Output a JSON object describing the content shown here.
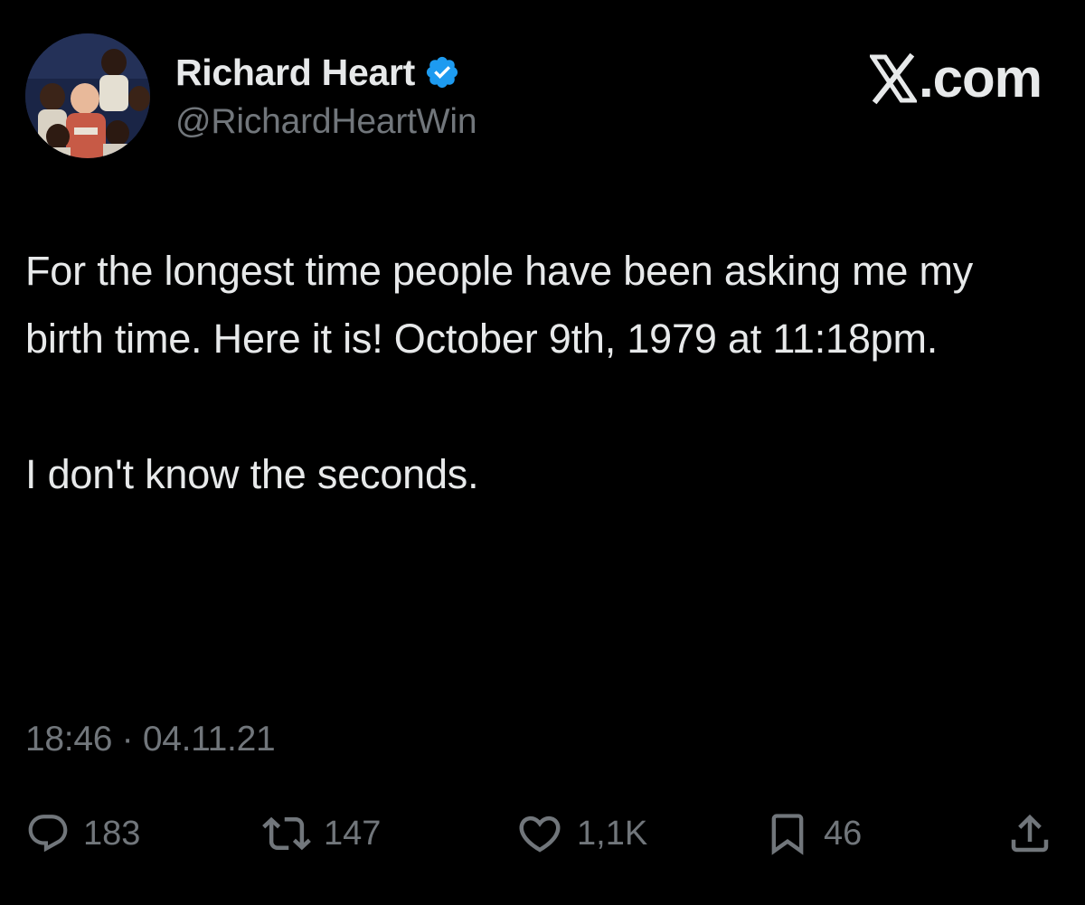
{
  "author": {
    "name": "Richard Heart",
    "handle": "@RichardHeartWin",
    "verified": true
  },
  "brand": {
    "label": ".com",
    "logo_icon": "x-logo-icon"
  },
  "tweet": {
    "paragraphs": [
      "For the longest time people have been asking me my birth time. Here it is! October 9th, 1979 at 11:18pm.",
      "I don't know the seconds."
    ],
    "timestamp": "18:46 · 04.11.21"
  },
  "actions": {
    "reply": {
      "icon": "reply-icon",
      "count": "183"
    },
    "repost": {
      "icon": "repost-icon",
      "count": "147"
    },
    "like": {
      "icon": "heart-icon",
      "count": "1,1K"
    },
    "bookmark": {
      "icon": "bookmark-icon",
      "count": "46"
    },
    "share": {
      "icon": "share-icon"
    }
  },
  "colors": {
    "background": "#000000",
    "primary_text": "#e7e9ea",
    "secondary_text": "#71767b",
    "verified_badge": "#1d9bf0"
  }
}
